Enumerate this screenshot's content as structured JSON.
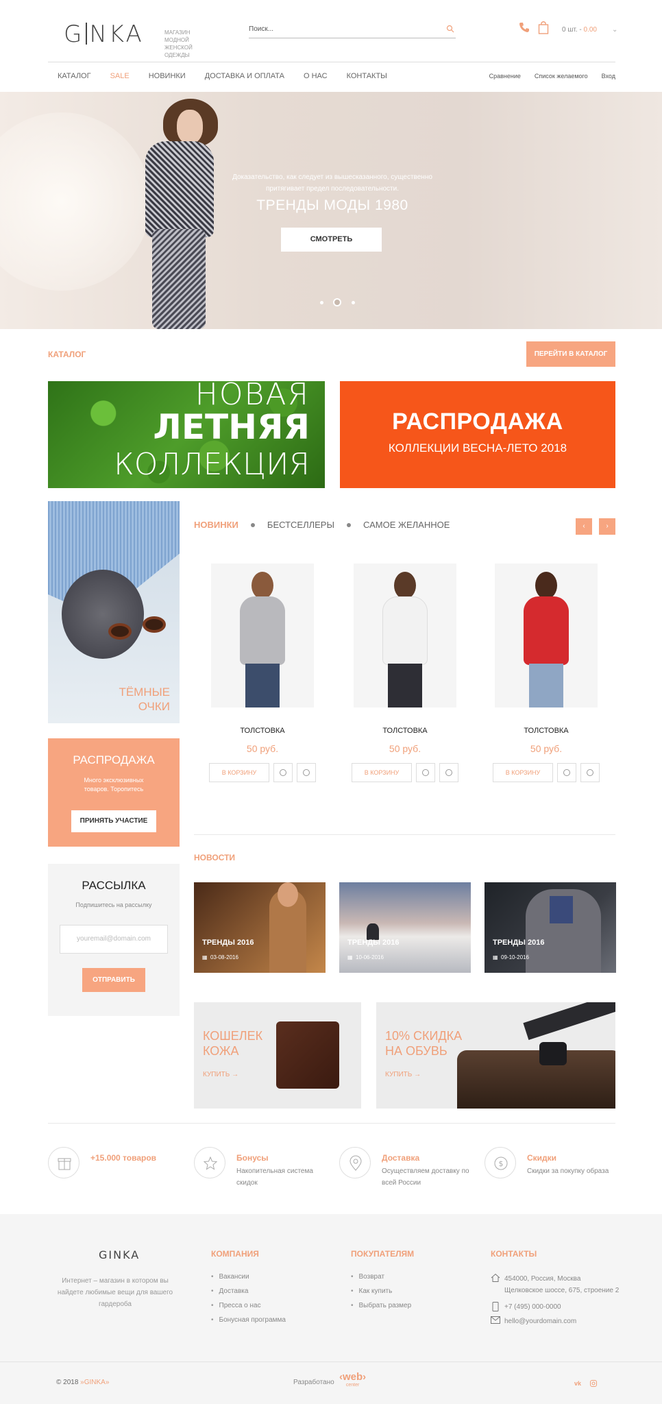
{
  "header": {
    "logo": "GINKA",
    "tagline": "магазин модной женской одежды",
    "search_placeholder": "Поиск...",
    "cart_label": "0 шт. - ",
    "cart_total": "0.00"
  },
  "nav": {
    "items": [
      "КАТАЛОГ",
      "SALE",
      "НОВИНКИ",
      "ДОСТАВКА И ОПЛАТА",
      "О НАС",
      "КОНТАКТЫ"
    ],
    "right": [
      "Сравнение",
      "Список желаемого",
      "Вход"
    ]
  },
  "hero": {
    "text": "Доказательство, как следует из вышесказанного, существенно притягивает предел последовательности.",
    "title": "ТРЕНДЫ МОДЫ 1980",
    "button": "СМОТРЕТЬ",
    "active_slide": 2,
    "slides": 3
  },
  "catalog": {
    "title": "КАТАЛОГ",
    "button": "ПЕРЕЙТИ В КАТАЛОГ",
    "banner_green": [
      "НОВАЯ",
      "ЛЕТНЯЯ",
      "КОЛЛЕКЦИЯ"
    ],
    "banner_orange_title": "РАСПРОДАЖА",
    "banner_orange_sub": "КОЛЛЕКЦИИ ВЕСНА-ЛЕТО 2018"
  },
  "sidebar": {
    "glasses_label_1": "ТЁМНЫЕ",
    "glasses_label_2": "ОЧКИ",
    "sale_title": "РАСПРОДАЖА",
    "sale_text": "Много эксклюзивных товаров. Торопитесь",
    "sale_button": "ПРИНЯТЬ УЧАСТИЕ",
    "newsletter_title": "РАССЫЛКА",
    "newsletter_text": "Подпишитесь на рассылку",
    "newsletter_placeholder": "youremail@domain.com",
    "newsletter_button": "ОТПРАВИТЬ"
  },
  "products": {
    "tabs": [
      "НОВИНКИ",
      "БЕСТСЕЛЛЕРЫ",
      "САМОЕ ЖЕЛАННОЕ"
    ],
    "prev": "‹",
    "next": "›",
    "items": [
      {
        "name": "ТОЛСТОВКА",
        "price": "50 руб.",
        "cart": "В КОРЗИНУ",
        "color": "#b9b9bd"
      },
      {
        "name": "ТОЛСТОВКА",
        "price": "50 руб.",
        "cart": "В КОРЗИНУ",
        "color": "#f2f2f2"
      },
      {
        "name": "ТОЛСТОВКА",
        "price": "50 руб.",
        "cart": "В КОРЗИНУ",
        "color": "#d52a2e"
      }
    ]
  },
  "news": {
    "title": "НОВОСТИ",
    "items": [
      {
        "title": "ТРЕНДЫ 2016",
        "date": "03-08-2016"
      },
      {
        "title": "ТРЕНДЫ 2016",
        "date": "10-06-2016"
      },
      {
        "title": "ТРЕНДЫ 2016",
        "date": "09-10-2016"
      }
    ]
  },
  "promos": [
    {
      "line1": "КОШЕЛЕК",
      "line2": "КОЖА",
      "buy": "КУПИТЬ  →"
    },
    {
      "line1": "10% СКИДКА",
      "line2": "НА ОБУВЬ",
      "buy": "КУПИТЬ  →"
    }
  ],
  "features": [
    {
      "title": "+15.000 товаров",
      "text": ""
    },
    {
      "title": "Бонусы",
      "text": "Накопительная система скидок"
    },
    {
      "title": "Доставка",
      "text": "Осуществляем доставку по всей России"
    },
    {
      "title": "Скидки",
      "text": "Скидки за покупку образа"
    }
  ],
  "footer": {
    "logo": "GINKA",
    "text": "Интернет – магазин в котором вы найдете любимые вещи для вашего гардероба",
    "company_title": "КОМПАНИЯ",
    "company": [
      "Вакансии",
      "Доставка",
      "Пресса о нас",
      "Бонусная программа"
    ],
    "buyers_title": "ПОКУПАТЕЛЯМ",
    "buyers": [
      "Возврат",
      "Как купить",
      "Выбрать размер"
    ],
    "contacts_title": "КОНТАКТЫ",
    "address_1": "454000, Россия, Москва",
    "address_2": "Щелковское шоссе, 675, строение 2",
    "phone": "+7 (495) 000-0000",
    "email": "hello@yourdomain.com",
    "copyright": "© 2018 ",
    "copyright_brand": "»GINKA»",
    "developed": "Разработано",
    "dev_logo": "‹web›",
    "dev_logo_sub": "center",
    "social": [
      "vk",
      "ig"
    ]
  }
}
